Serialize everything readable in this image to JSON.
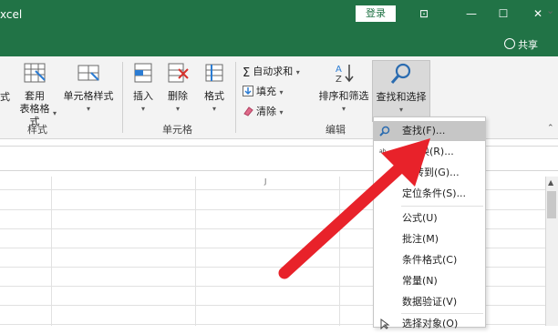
{
  "window": {
    "title": "xcel",
    "login": "登录",
    "share": "共享",
    "controls": [
      "⊡",
      "—",
      "☐",
      "✕"
    ]
  },
  "ribbon": {
    "styles_group": {
      "label": "样式",
      "partial_label": "式",
      "table_format": [
        "套用",
        "表格格式"
      ],
      "cell_style": "单元格样式"
    },
    "cells_group": {
      "label": "单元格",
      "insert": "插入",
      "delete": "删除",
      "format": "格式"
    },
    "editing_group": {
      "label": "编辑",
      "autosum": "自动求和",
      "fill": "填充",
      "clear": "清除",
      "sort_filter": "排序和筛选",
      "find_select": "查找和选择"
    }
  },
  "column_header_mark": "J",
  "menu": {
    "items": [
      {
        "label": "查找(F)...",
        "icon": "magnifier-icon",
        "highlighted": true
      },
      {
        "label": "替换(R)...",
        "partial": "换(R)...",
        "icon": "replace-icon"
      },
      {
        "label": "转到(G)...",
        "partial": "转到(G)...",
        "icon": ""
      },
      {
        "label": "定位条件(S)...",
        "icon": ""
      },
      {
        "label": "公式(U)",
        "icon": ""
      },
      {
        "label": "批注(M)",
        "icon": ""
      },
      {
        "label": "条件格式(C)",
        "icon": ""
      },
      {
        "label": "常量(N)",
        "icon": ""
      },
      {
        "label": "数据验证(V)",
        "icon": ""
      },
      {
        "label": "选择对象(O)",
        "icon": "pointer-icon"
      }
    ]
  },
  "colors": {
    "title_bar": "#217346",
    "ribbon_bg": "#f3f3f3",
    "menu_highlight": "#c6c6c6",
    "arrow": "#e8222a"
  }
}
